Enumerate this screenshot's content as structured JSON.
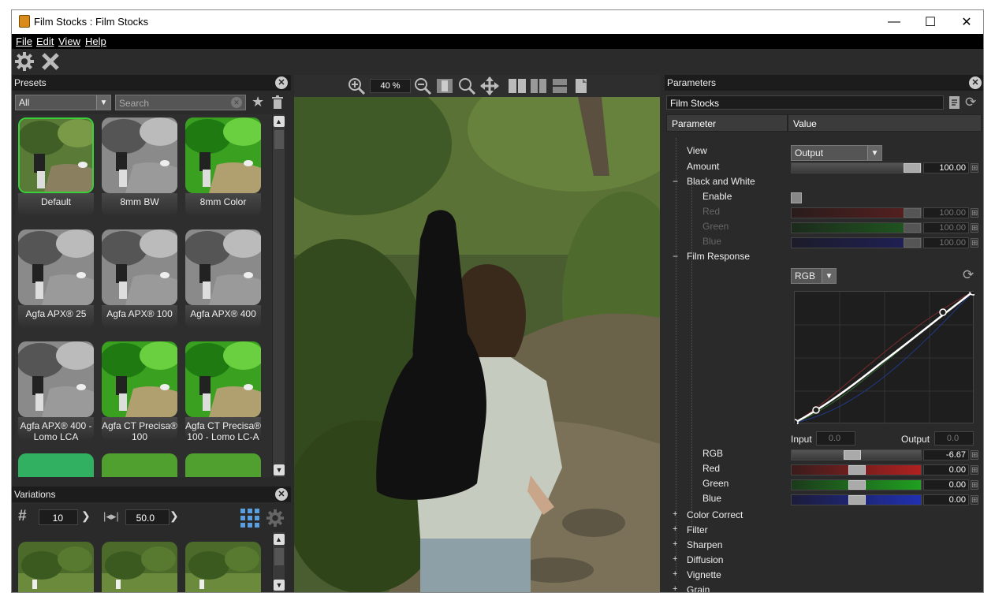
{
  "window": {
    "title": "Film Stocks : Film Stocks",
    "minimize": "—",
    "maximize": "☐",
    "close": "✕"
  },
  "menu": [
    {
      "label": "File"
    },
    {
      "label": "Edit"
    },
    {
      "label": "View"
    },
    {
      "label": "Help"
    }
  ],
  "presets": {
    "header": "Presets",
    "filter": "All",
    "search_placeholder": "Search",
    "items": [
      {
        "label": "Default",
        "style": "color",
        "selected": true
      },
      {
        "label": "8mm BW",
        "style": "bw"
      },
      {
        "label": "8mm Color",
        "style": "vivid"
      },
      {
        "label": "Agfa APX® 25",
        "style": "bw"
      },
      {
        "label": "Agfa APX® 100",
        "style": "bw"
      },
      {
        "label": "Agfa APX® 400",
        "style": "bw"
      },
      {
        "label": "Agfa APX® 400 - Lomo LCA",
        "style": "bw"
      },
      {
        "label": "Agfa CT Precisa® 100",
        "style": "vivid"
      },
      {
        "label": "Agfa CT Precisa® 100 - Lomo LC-A",
        "style": "vivid"
      }
    ]
  },
  "variations": {
    "header": "Variations",
    "count": "10",
    "amount": "50.0"
  },
  "viewer": {
    "zoom": "40 %"
  },
  "parameters": {
    "header": "Parameters",
    "preset_name": "Film Stocks",
    "col_param": "Parameter",
    "col_value": "Value",
    "view_label": "View",
    "view_value": "Output",
    "amount_label": "Amount",
    "amount_value": "100.00",
    "amount_level": 1.0,
    "bw_label": "Black and White",
    "enable_label": "Enable",
    "bw_red_label": "Red",
    "bw_red_value": "100.00",
    "bw_green_label": "Green",
    "bw_green_value": "100.00",
    "bw_blue_label": "Blue",
    "bw_blue_value": "100.00",
    "film_response_label": "Film Response",
    "curve_channel": "RGB",
    "input_label": "Input",
    "input_value": "0.0",
    "output_label": "Output",
    "output_value": "0.0",
    "rgb_label": "RGB",
    "rgb_value": "-6.67",
    "red_label": "Red",
    "red_value": "0.00",
    "green_label": "Green",
    "green_value": "0.00",
    "blue_label": "Blue",
    "blue_value": "0.00",
    "groups": [
      "Color Correct",
      "Filter",
      "Sharpen",
      "Diffusion",
      "Vignette",
      "Grain"
    ]
  },
  "colors": {
    "accent_selected": "#39d13a",
    "panel_bg": "#2a2a2a"
  }
}
